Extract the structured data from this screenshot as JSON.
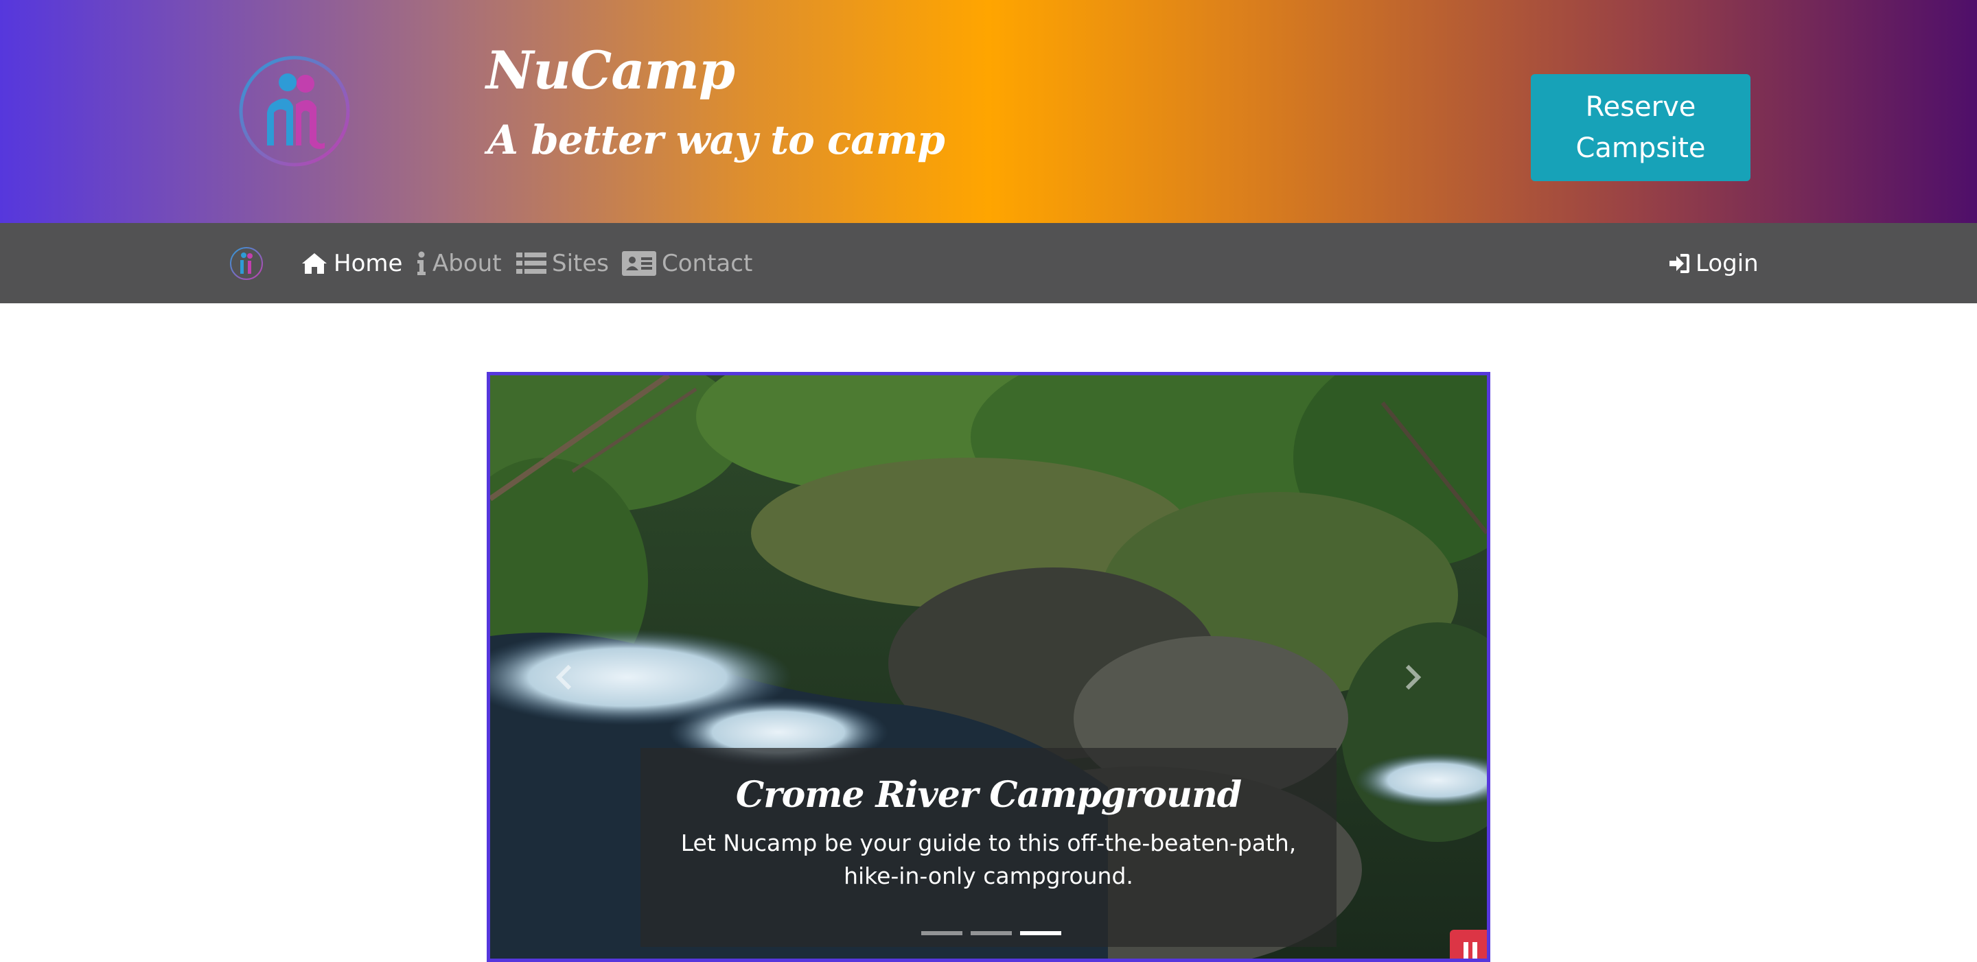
{
  "header": {
    "title": "NuCamp",
    "tagline": "A better way to camp",
    "reserve_line1": "Reserve",
    "reserve_line2": "Campsite"
  },
  "navbar": {
    "items": [
      {
        "label": "Home",
        "icon": "home-icon",
        "active": true
      },
      {
        "label": "About",
        "icon": "info-icon",
        "active": false
      },
      {
        "label": "Sites",
        "icon": "list-icon",
        "active": false
      },
      {
        "label": "Contact",
        "icon": "address-card-icon",
        "active": false
      }
    ],
    "login_label": "Login"
  },
  "carousel": {
    "caption_title": "Crome River Campground",
    "caption_text": "Let Nucamp be your guide to this off-the-beaten-path, hike-in-only campground.",
    "active_slide": 3,
    "slide_count": 3
  },
  "colors": {
    "brand_purple": "#5637dd",
    "reserve_button": "#17a2b8",
    "navbar": "#525253",
    "pause_button": "#dc3545"
  }
}
